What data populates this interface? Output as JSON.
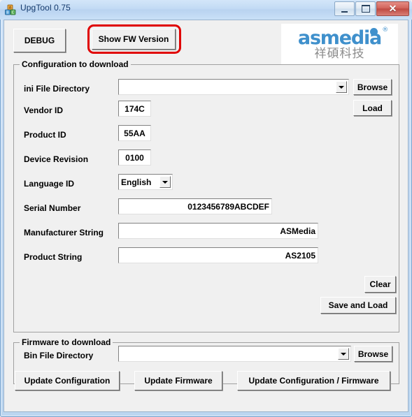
{
  "window": {
    "title": "UpgTool 0.75",
    "icon": "app-blocks-icon",
    "caption_buttons": [
      {
        "name": "minimize",
        "glyph": "minimize-icon"
      },
      {
        "name": "maximize",
        "glyph": "maximize-icon"
      },
      {
        "name": "close",
        "glyph": "✕"
      }
    ]
  },
  "toolbar": {
    "debug_label": "DEBUG",
    "show_fw_version_label": "Show FW Version"
  },
  "logo": {
    "name": "asmedia",
    "registered_mark": "®",
    "chinese": "祥碩科技",
    "brand_color": "#3f90cc",
    "sub_color": "#8c8c8c"
  },
  "annotation": {
    "color": "#e00000",
    "target": "show-fw-version-button"
  },
  "config_group": {
    "title": "Configuration to download",
    "rows": [
      {
        "label": "ini File Directory",
        "value": "",
        "placeholder": "",
        "control": "combobox"
      },
      {
        "label": "Vendor ID",
        "value": "174C",
        "control": "textbox"
      },
      {
        "label": "Product ID",
        "value": "55AA",
        "control": "textbox"
      },
      {
        "label": "Device Revision",
        "value": "0100",
        "control": "textbox"
      },
      {
        "label": "Language ID",
        "value": "English",
        "control": "combobox"
      },
      {
        "label": "Serial Number",
        "value": "0123456789ABCDEF",
        "control": "textbox"
      },
      {
        "label": "Manufacturer String",
        "value": "ASMedia",
        "control": "textbox"
      },
      {
        "label": "Product String",
        "value": "AS2105",
        "control": "textbox"
      }
    ],
    "browse_label": "Browse",
    "load_label": "Load",
    "clear_label": "Clear",
    "save_and_load_label": "Save and Load"
  },
  "firmware_group": {
    "title": "Firmware to download",
    "bin_label": "Bin File Directory",
    "bin_value": "",
    "browse_label": "Browse"
  },
  "actions": {
    "update_configuration_label": "Update Configuration",
    "update_firmware_label": "Update Firmware",
    "update_config_firmware_label": "Update Configuration / Firmware"
  }
}
